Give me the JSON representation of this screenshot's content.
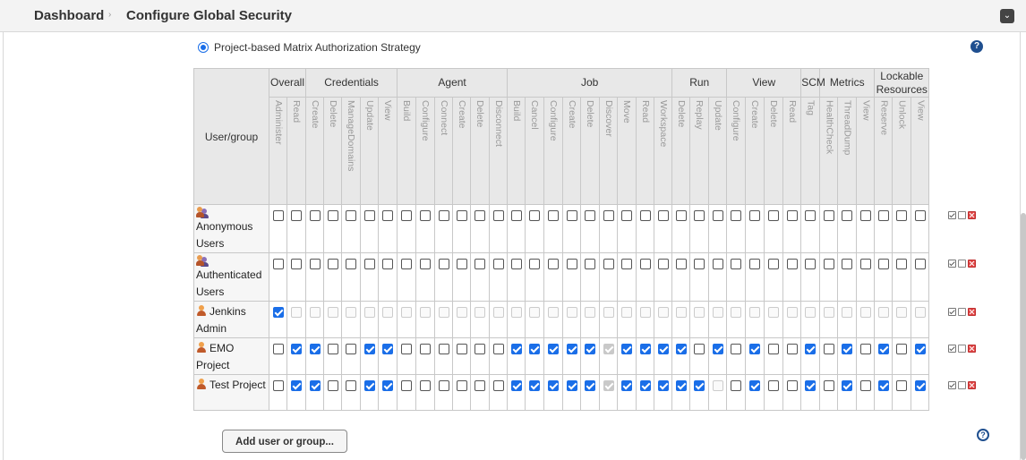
{
  "breadcrumb": {
    "root": "Dashboard",
    "separator": "›",
    "current": "Configure Global Security"
  },
  "strategy": {
    "label": "Project-based Matrix Authorization Strategy",
    "selected": true
  },
  "help_text": "?",
  "matrix": {
    "user_group_header": "User/group",
    "groups": [
      {
        "label": "Overall",
        "span": 2
      },
      {
        "label": "Credentials",
        "span": 5
      },
      {
        "label": "Agent",
        "span": 6
      },
      {
        "label": "Job",
        "span": 9
      },
      {
        "label": "Run",
        "span": 3
      },
      {
        "label": "View",
        "span": 4
      },
      {
        "label": "SCM",
        "span": 1
      },
      {
        "label": "Metrics",
        "span": 3
      },
      {
        "label": "Lockable Resources",
        "span": 3
      }
    ],
    "permissions": [
      "Administer",
      "Read",
      "Create",
      "Delete",
      "ManageDomains",
      "Update",
      "View",
      "Build",
      "Configure",
      "Connect",
      "Create",
      "Delete",
      "Disconnect",
      "Build",
      "Cancel",
      "Configure",
      "Create",
      "Delete",
      "Discover",
      "Move",
      "Read",
      "Workspace",
      "Delete",
      "Replay",
      "Update",
      "Configure",
      "Create",
      "Delete",
      "Read",
      "Tag",
      "HealthCheck",
      "ThreadDump",
      "View",
      "Reserve",
      "Unlock",
      "View"
    ],
    "rows": [
      {
        "name": "Anonymous Users",
        "type": "group",
        "states": "000000000000000000000000000000000000"
      },
      {
        "name": "Authenticated Users",
        "type": "group",
        "states": "000000000000000000000000000000000000"
      },
      {
        "name": "Jenkins Admin",
        "type": "user",
        "states": "1ddddddddddddddddddddddddddddddddddd"
      },
      {
        "name": "EMO Project",
        "type": "user",
        "states": "011001100000011111x11110101001010101"
      },
      {
        "name": "Test Project",
        "type": "user",
        "states": "011001100000011111x11111d01001010101"
      }
    ]
  },
  "add_button": {
    "label": "Add user or group..."
  }
}
